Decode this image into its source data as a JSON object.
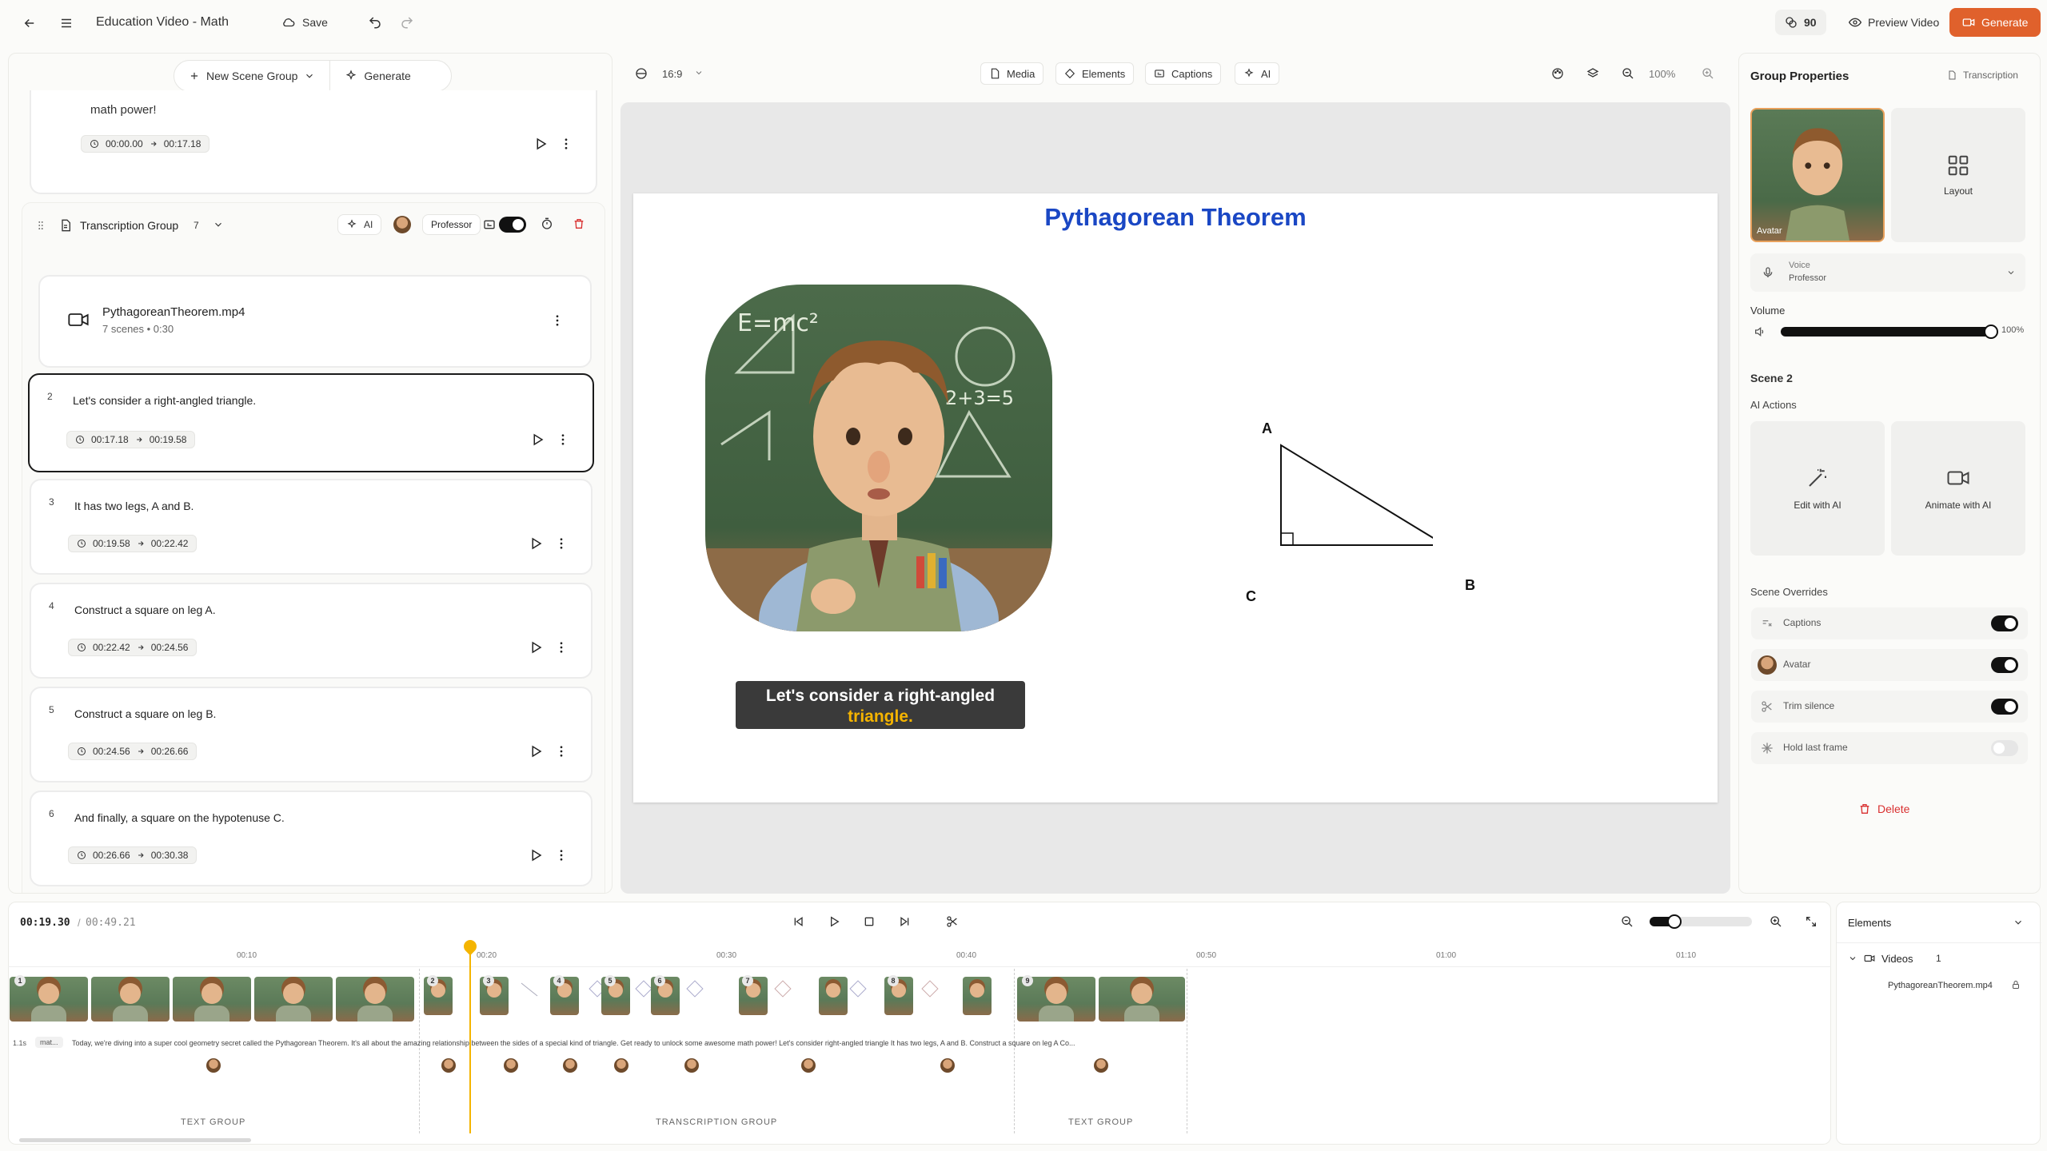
{
  "header": {
    "title": "Education Video - Math",
    "save": "Save",
    "credits": "90",
    "preview": "Preview Video",
    "generate": "Generate"
  },
  "scene_panel": {
    "new_group": "New Scene Group",
    "generate": "Generate"
  },
  "intro_card": {
    "text": "math power!",
    "start": "00:00.00",
    "end": "00:17.18"
  },
  "group": {
    "title": "Transcription Group",
    "count": "7",
    "ai": "AI",
    "voice": "Professor"
  },
  "file": {
    "name": "PythagoreanTheorem.mp4",
    "meta": "7 scenes • 0:30"
  },
  "scenes": [
    {
      "num": "2",
      "text": "Let's consider a right-angled triangle.",
      "start": "00:17.18",
      "end": "00:19.58"
    },
    {
      "num": "3",
      "text": "It has two legs, A and B.",
      "start": "00:19.58",
      "end": "00:22.42"
    },
    {
      "num": "4",
      "text": "Construct a square on leg A.",
      "start": "00:22.42",
      "end": "00:24.56"
    },
    {
      "num": "5",
      "text": "Construct a square on leg B.",
      "start": "00:24.56",
      "end": "00:26.66"
    },
    {
      "num": "6",
      "text": "And finally, a square on the hypotenuse C.",
      "start": "00:26.66",
      "end": "00:30.38"
    }
  ],
  "canvas_toolbar": {
    "ratio": "16:9",
    "media": "Media",
    "elements": "Elements",
    "captions": "Captions",
    "ai": "AI",
    "zoom": "100%"
  },
  "canvas": {
    "title": "Pythagorean Theorem",
    "caption_main": "Let's consider a right-angled",
    "caption_hl": "triangle.",
    "label_a": "A",
    "label_b": "B",
    "label_c": "C"
  },
  "props": {
    "title": "Group Properties",
    "transcription": "Transcription",
    "avatar_tag": "Avatar",
    "layout": "Layout",
    "voice_label": "Voice",
    "voice_value": "Professor",
    "volume_label": "Volume",
    "volume_value": "100%",
    "scene_title": "Scene 2",
    "ai_actions": "AI Actions",
    "edit_ai": "Edit with AI",
    "animate_ai": "Animate with AI",
    "overrides": "Scene Overrides",
    "ov_captions": "Captions",
    "ov_avatar": "Avatar",
    "ov_trim": "Trim silence",
    "ov_hold": "Hold last frame",
    "delete": "Delete"
  },
  "timeline": {
    "current": "00:19.30",
    "total": "00:49.21",
    "ticks": [
      "00:10",
      "00:20",
      "00:30",
      "00:40",
      "00:50",
      "01:00",
      "01:10"
    ],
    "transcript": "Today, we're diving into a super cool geometry secret called the Pythagorean Theorem. It's all about the amazing relationship between the sides of a special kind of triangle. Get ready to unlock some awesome math power! Let's consider right-angled triangle It has two legs, A and B. Construct a square on leg A Co...",
    "speed": "1.1s",
    "mat": "mat...",
    "group_text_1": "TEXT GROUP",
    "group_transcription": "TRANSCRIPTION GROUP",
    "group_text_2": "TEXT GROUP",
    "badges": [
      "1",
      "2",
      "3",
      "4",
      "5",
      "6",
      "7",
      "8",
      "9"
    ]
  },
  "elements_panel": {
    "title": "Elements",
    "videos": "Videos",
    "videos_count": "1",
    "file": "PythagoreanTheorem.mp4"
  }
}
